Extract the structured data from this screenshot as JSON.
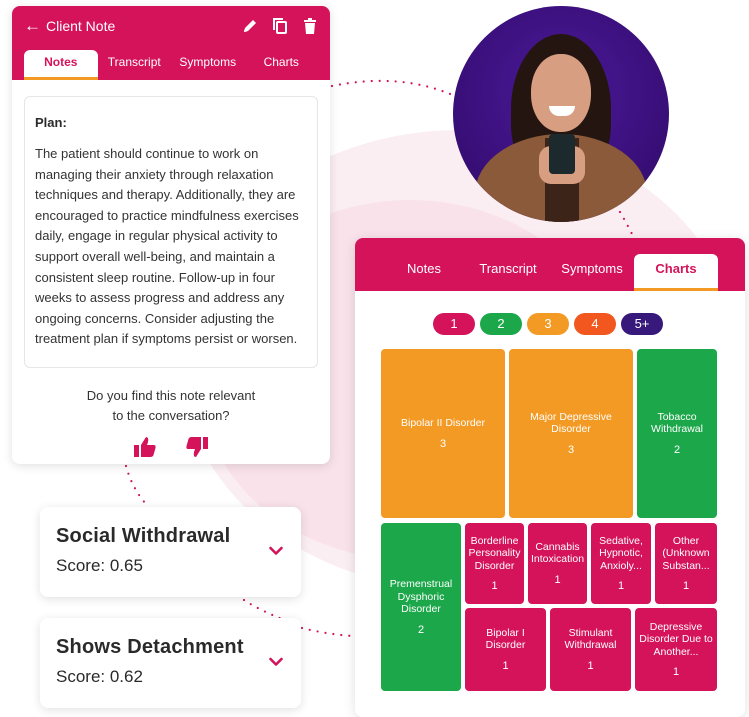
{
  "colors": {
    "brand": "#d4135a",
    "accent": "#f39a25",
    "level1": "#d4135a",
    "level2": "#1ca84a",
    "level3": "#f39a25",
    "level4": "#f2571f",
    "level5": "#36197a"
  },
  "note": {
    "back_icon": "arrow-left-icon",
    "title": "Client Note",
    "actions": [
      "pencil-icon",
      "copy-icon",
      "trash-icon"
    ],
    "tabs": [
      "Notes",
      "Transcript",
      "Symptoms",
      "Charts"
    ],
    "active_tab": "Notes",
    "heading": "Plan:",
    "body": "The patient should continue to work on managing their anxiety through relaxation techniques and therapy. Additionally, they are encouraged to practice mindfulness exercises daily, engage in regular physical activity to support overall well-being, and maintain a consistent sleep routine. Follow-up in four weeks to assess progress and address any ongoing concerns. Consider adjusting the treatment plan if symptoms persist or worsen.",
    "relevance_line1": "Do you find this note relevant",
    "relevance_line2": "to the conversation?",
    "feedback_icons": [
      "thumbs-up-icon",
      "thumbs-down-icon"
    ]
  },
  "symptoms": [
    {
      "label": "Social Withdrawal",
      "score": "Score: 0.65",
      "icon": "chevron-down-icon"
    },
    {
      "label": "Shows Detachment",
      "score": "Score: 0.62",
      "icon": "chevron-down-icon"
    }
  ],
  "charts": {
    "tabs": [
      "Notes",
      "Transcript",
      "Symptoms",
      "Charts"
    ],
    "active_tab": "Charts",
    "legend": [
      "1",
      "2",
      "3",
      "4",
      "5+"
    ]
  },
  "chart_data": {
    "type": "treemap",
    "items": [
      {
        "name": "Bipolar II Disorder",
        "value": 3,
        "level": "3"
      },
      {
        "name": "Major Depressive Disorder",
        "value": 3,
        "level": "3"
      },
      {
        "name": "Tobacco Withdrawal",
        "value": 2,
        "level": "2"
      },
      {
        "name": "Premenstrual Dysphoric Disorder",
        "value": 2,
        "level": "2"
      },
      {
        "name": "Borderline Personality Disorder",
        "value": 1,
        "level": "1"
      },
      {
        "name": "Cannabis Intoxication",
        "value": 1,
        "level": "1"
      },
      {
        "name": "Sedative, Hypnotic, Anxioly...",
        "value": 1,
        "level": "1"
      },
      {
        "name": "Other (Unknown Substan...",
        "value": 1,
        "level": "1"
      },
      {
        "name": "Bipolar I Disorder",
        "value": 1,
        "level": "1"
      },
      {
        "name": "Stimulant Withdrawal",
        "value": 1,
        "level": "1"
      },
      {
        "name": "Depressive Disorder Due to Another...",
        "value": 1,
        "level": "1"
      }
    ]
  }
}
